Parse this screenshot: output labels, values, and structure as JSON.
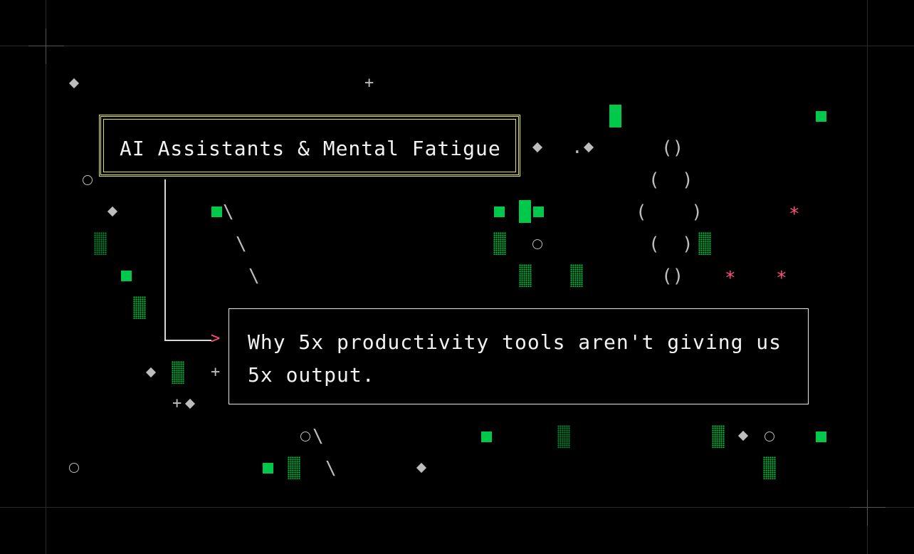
{
  "title": "AI Assistants & Mental Fatigue",
  "subtitle_line1": "Why 5x productivity tools aren't giving us",
  "subtitle_line2": "5x output.",
  "connector_arrow": ">",
  "decorations": {
    "plus": "+",
    "dot_prefix": ".",
    "backslash": "\\",
    "asterisk": "*",
    "paren_row1": "()",
    "paren_row2": "(  )",
    "paren_row3": "(    )",
    "paren_row4": "(  )",
    "paren_row5": "()"
  },
  "colors": {
    "background": "#000000",
    "accent_green": "#00c84a",
    "accent_pink": "#ff4f7b",
    "title_border": "#e6e63a",
    "text": "#f2f2f2"
  }
}
